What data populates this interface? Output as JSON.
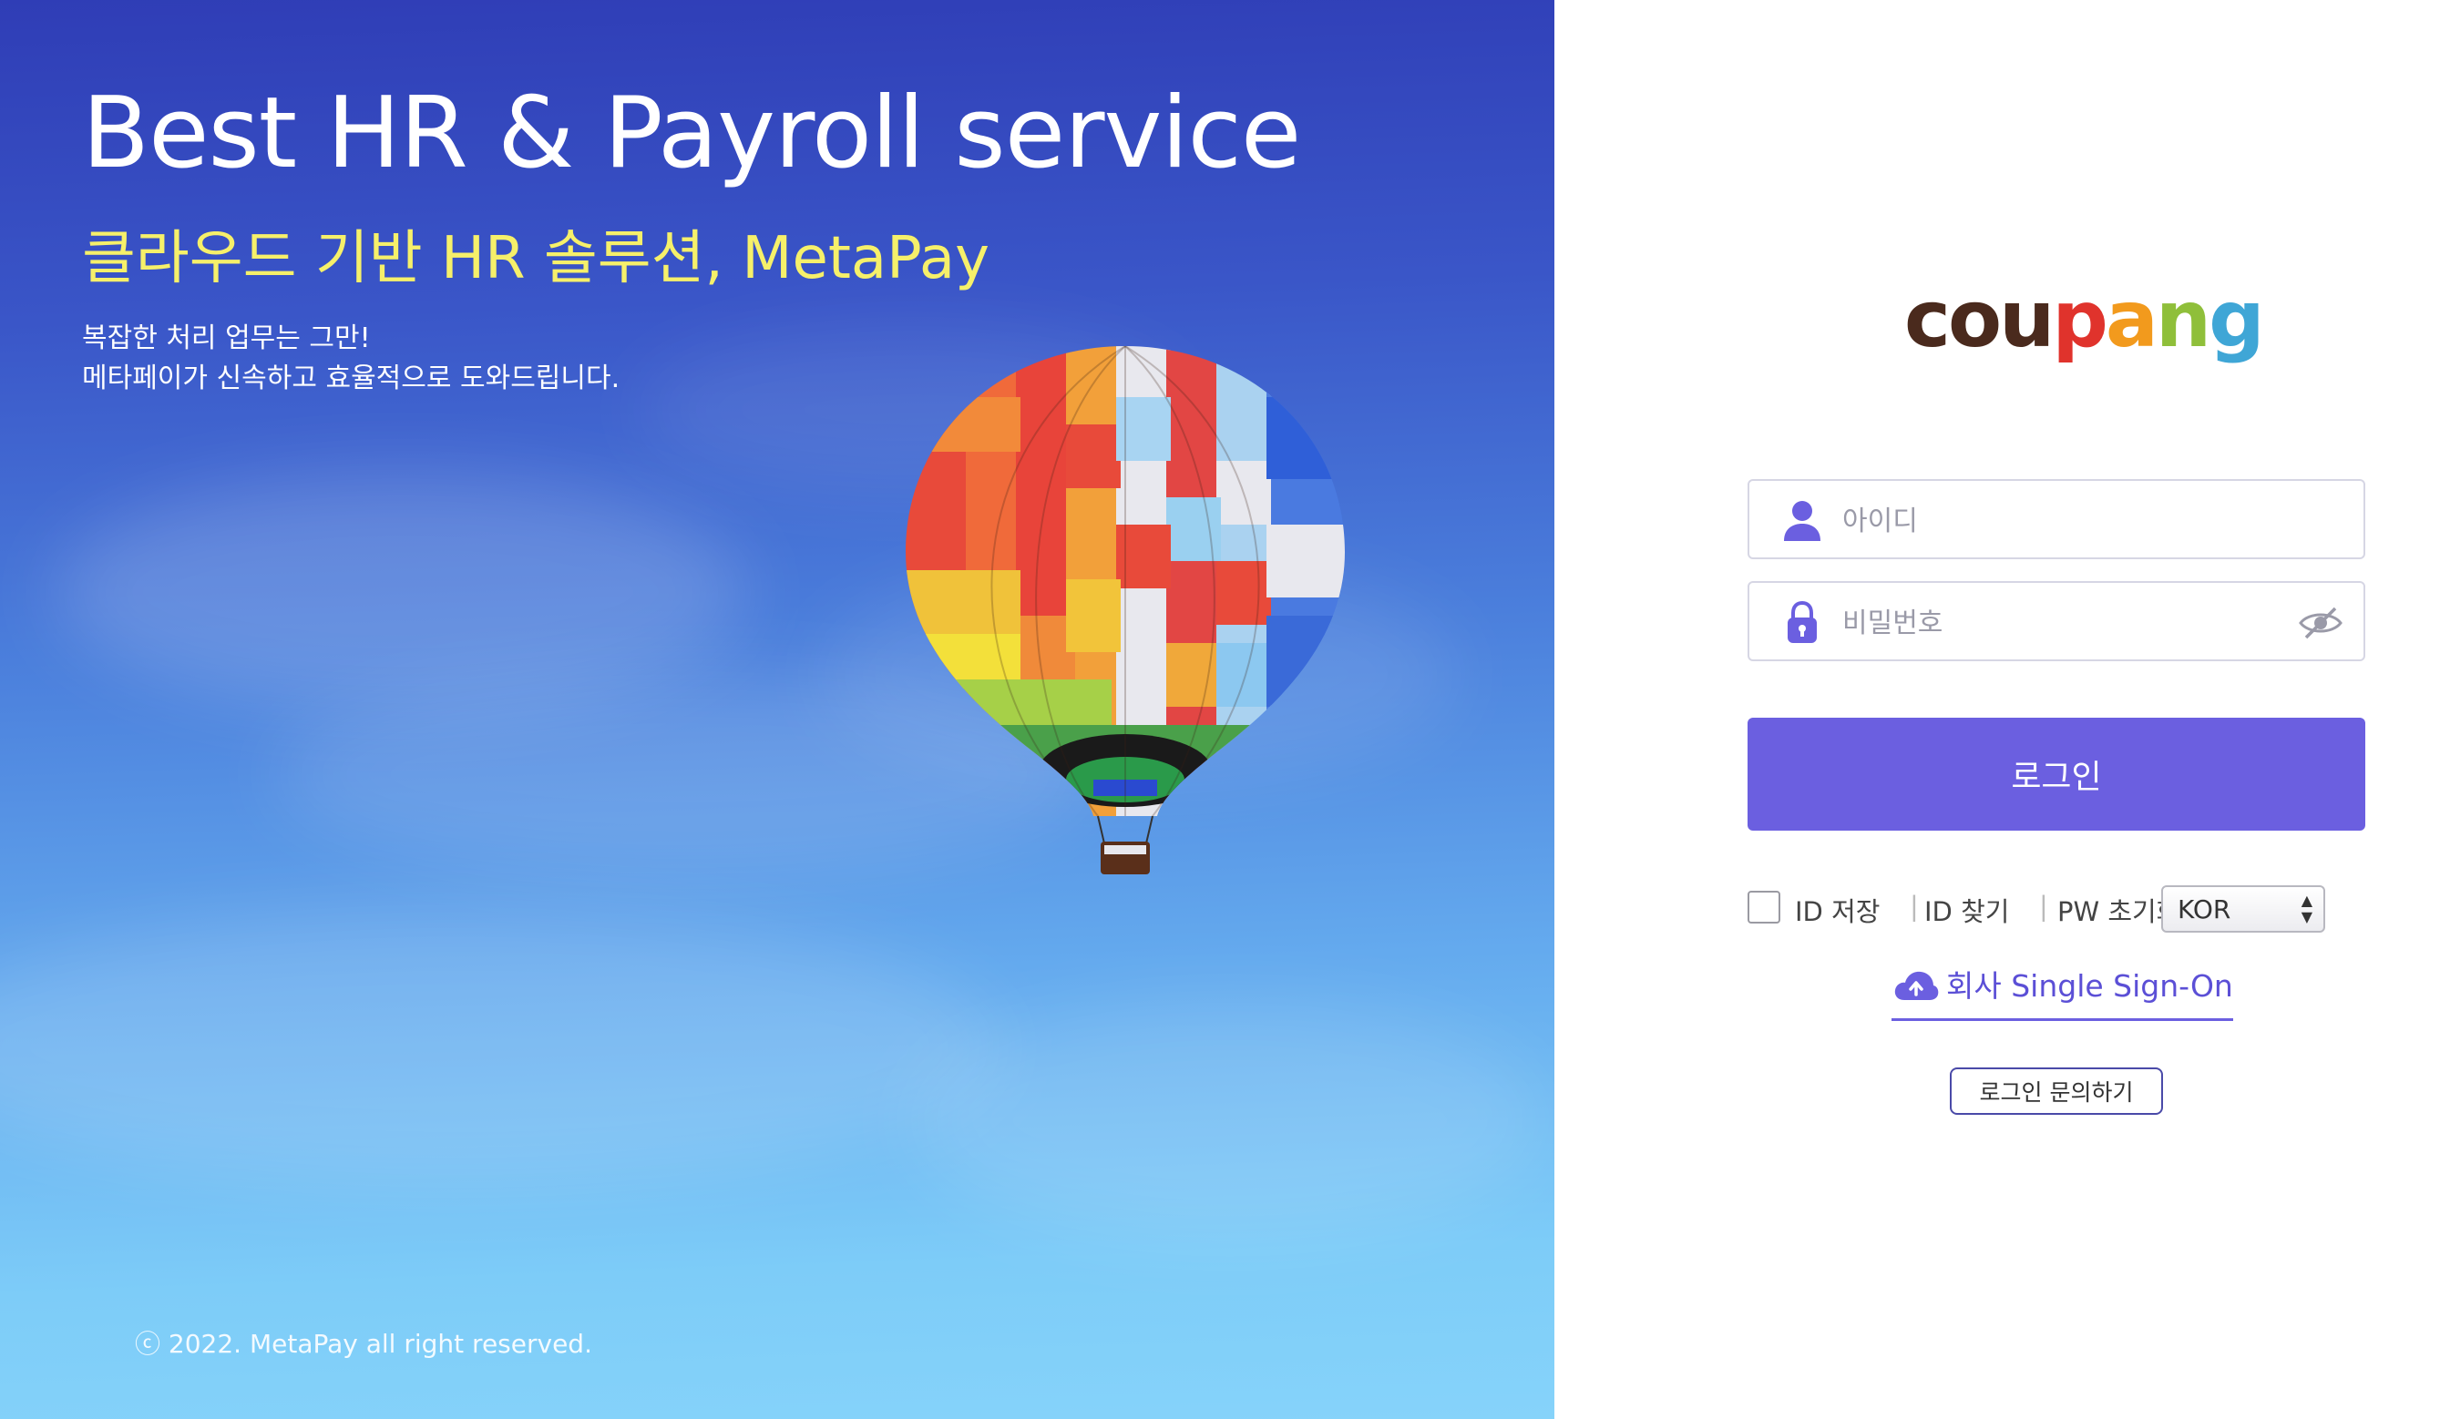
{
  "hero": {
    "title": "Best HR & Payroll service",
    "subtitle": "클라우드 기반 HR 솔루션, MetaPay",
    "desc_line1": "복잡한 처리 업무는 그만!",
    "desc_line2": "메타페이가 신속하고 효율적으로 도와드립니다.",
    "copyright": "ⓒ 2022. MetaPay all right reserved.",
    "balloon_icon": "hot-air-balloon-image"
  },
  "login": {
    "logo_letters": [
      "c",
      "o",
      "u",
      "p",
      "a",
      "n",
      "g"
    ],
    "id_placeholder": "아이디",
    "pw_placeholder": "비밀번호",
    "login_button": "로그인",
    "save_id": "ID 저장",
    "find_id": "ID 찾기",
    "reset_pw": "PW 초기화",
    "language": "KOR",
    "sso_label": "회사 Single Sign-On",
    "inquiry": "로그인 문의하기",
    "separator": "|"
  },
  "colors": {
    "accent": "#6b5fe0",
    "subtitle_yellow": "#f6f06a",
    "sky_top": "#2f3db6",
    "sky_bottom": "#86d3fa"
  },
  "icons": {
    "id_field": "user-icon",
    "pw_field": "lock-icon",
    "pw_toggle": "eye-slash-icon",
    "sso": "cloud-upload-icon"
  }
}
